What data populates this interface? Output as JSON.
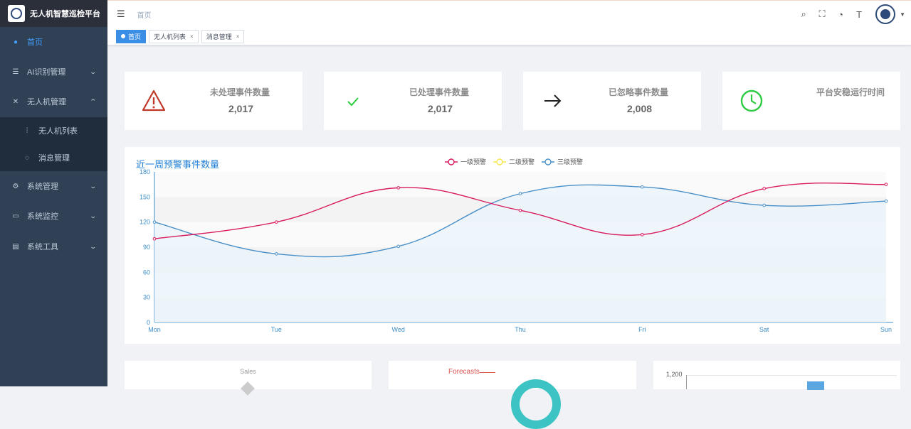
{
  "app": {
    "title": "无人机智慧巡检平台"
  },
  "sidebar": {
    "items": [
      {
        "label": "首页",
        "icon": "dashboard-icon"
      },
      {
        "label": "AI识别管理",
        "icon": "list-icon"
      },
      {
        "label": "无人机管理",
        "icon": "drone-icon"
      },
      {
        "label": "无人机列表",
        "icon": "sliders-icon"
      },
      {
        "label": "消息管理",
        "icon": "message-icon"
      },
      {
        "label": "系统管理",
        "icon": "gear-icon"
      },
      {
        "label": "系统监控",
        "icon": "monitor-icon"
      },
      {
        "label": "系统工具",
        "icon": "toolbox-icon"
      }
    ]
  },
  "navbar": {
    "breadcrumb": "首页"
  },
  "tags": [
    {
      "label": "首页"
    },
    {
      "label": "无人机列表"
    },
    {
      "label": "消息管理"
    }
  ],
  "stats": [
    {
      "title": "未处理事件数量",
      "value": "2,017",
      "icon": "warning-icon",
      "color": "#c0392b"
    },
    {
      "title": "已处理事件数量",
      "value": "2,017",
      "icon": "check-icon",
      "color": "#2ecc40"
    },
    {
      "title": "已忽略事件数量",
      "value": "2,008",
      "icon": "arrow-right-icon",
      "color": "#222222"
    },
    {
      "title": "平台安稳运行时间",
      "value": "",
      "icon": "clock-icon",
      "color": "#2ecc40"
    }
  ],
  "chart_data": {
    "type": "line",
    "title": "近一周预警事件数量",
    "categories": [
      "Mon",
      "Tue",
      "Wed",
      "Thu",
      "Fri",
      "Sat",
      "Sun"
    ],
    "ylim": [
      0,
      180
    ],
    "yticks": [
      0,
      30,
      60,
      90,
      120,
      150,
      180
    ],
    "legend_position": "top-center",
    "series": [
      {
        "name": "一级预警",
        "color": "#d81b60",
        "values": [
          100,
          120,
          161,
          134,
          105,
          160,
          165
        ]
      },
      {
        "name": "二级预警",
        "color": "#f5e94a",
        "values": []
      },
      {
        "name": "三级预警",
        "color": "#4a90c8",
        "values": [
          120,
          82,
          91,
          154,
          162,
          140,
          145
        ]
      }
    ]
  },
  "bottom_panels": {
    "left_title": "Sales",
    "mid_label": "Forecasts",
    "right_tick": "1,200"
  }
}
